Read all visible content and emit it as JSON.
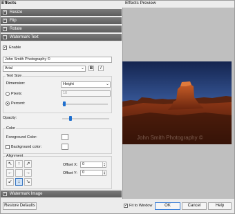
{
  "panels": {
    "left_title": "Effects",
    "right_title": "Effects Preview"
  },
  "sections": [
    {
      "label": "Resize",
      "icon": "plus-icon"
    },
    {
      "label": "Flip",
      "icon": "plus-icon"
    },
    {
      "label": "Rotate",
      "icon": "plus-icon"
    },
    {
      "label": "Watermark Text",
      "icon": "minus-icon"
    },
    {
      "label": "Watermark Image",
      "icon": "plus-icon"
    }
  ],
  "watermark_text": {
    "enable_label": "Enable",
    "enable_checked": true,
    "text_value": "John Smith Photography ©",
    "font_value": "Arial",
    "bold_label": "B",
    "italic_label": "I",
    "text_size_title": "Text Size",
    "dimension_label": "Dimension:",
    "dimension_value": "Height",
    "pixels_label": "Pixels:",
    "pixels_value": "10",
    "percent_label": "Percent:",
    "percent_selected": true,
    "percent_slider": 0.04,
    "opacity_label": "Opacity:",
    "opacity_slider": 0.17,
    "color_title": "Color",
    "foreground_label": "Foreground Color:",
    "background_label": "Background color:",
    "background_checked": false,
    "alignment_title": "Alignment",
    "align_glyphs": [
      "↖",
      "↑",
      "↗",
      "←",
      "",
      "→",
      "↙",
      "↓",
      "↘"
    ],
    "align_selected": 7,
    "offset_x_label": "Offset X:",
    "offset_x_value": "0",
    "offset_y_label": "Offset Y:",
    "offset_y_value": "0"
  },
  "preview": {
    "watermark": "John Smith Photography ©"
  },
  "footer": {
    "restore_label": "Restore Defaults",
    "fit_label": "Fit to Window",
    "fit_checked": true,
    "ok_label": "OK",
    "cancel_label": "Cancel",
    "help_label": "Help"
  },
  "colors": {
    "section_bar": "#6a6a6a",
    "accent": "#1e6fcf",
    "preview_bg": "#bfbfbf"
  }
}
